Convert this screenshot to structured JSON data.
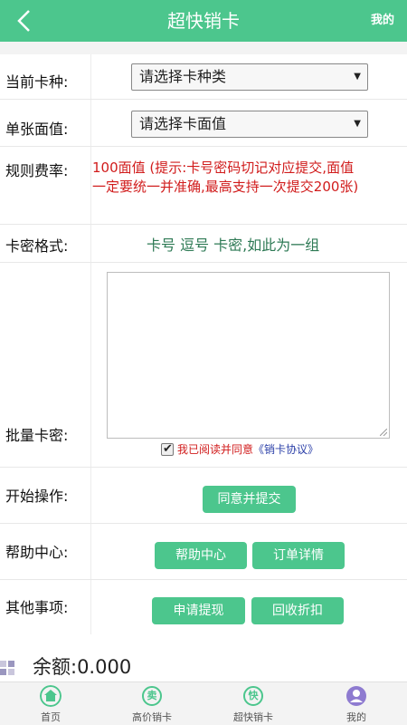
{
  "header": {
    "title": "超快销卡",
    "right_link": "我的"
  },
  "form": {
    "card_type": {
      "label": "当前卡种:",
      "value": "请选择卡种类"
    },
    "face_value": {
      "label": "单张面值:",
      "value": "请选择卡面值"
    },
    "rate": {
      "label": "规则费率:",
      "text": "100面值 (提示:卡号密码切记对应提交,面值一定要统一并准确,最高支持一次提交200张)"
    },
    "format": {
      "label": "卡密格式:",
      "text": "卡号 逗号 卡密,如此为一组"
    },
    "batch": {
      "label": "批量卡密:",
      "agree_prefix": "我已阅读并同意",
      "agree_link": "《销卡协议》",
      "checked": true
    },
    "start": {
      "label": "开始操作:",
      "submit_button": "同意并提交"
    },
    "help": {
      "label": "帮助中心:",
      "help_button": "帮助中心",
      "orders_button": "订单详情"
    },
    "other": {
      "label": "其他事项:",
      "withdraw_button": "申请提现",
      "discount_button": "回收折扣"
    }
  },
  "balance": {
    "text": "余额:0.000"
  },
  "tabbar": [
    {
      "label": "首页",
      "icon": "home-icon"
    },
    {
      "label": "高价销卡",
      "icon": "sell-icon",
      "glyph": "卖"
    },
    {
      "label": "超快销卡",
      "icon": "fast-icon",
      "glyph": "快"
    },
    {
      "label": "我的",
      "icon": "user-icon"
    }
  ],
  "colors": {
    "accent": "#4cc68d",
    "warning": "#d11c1c",
    "link": "#2b3fa8"
  }
}
